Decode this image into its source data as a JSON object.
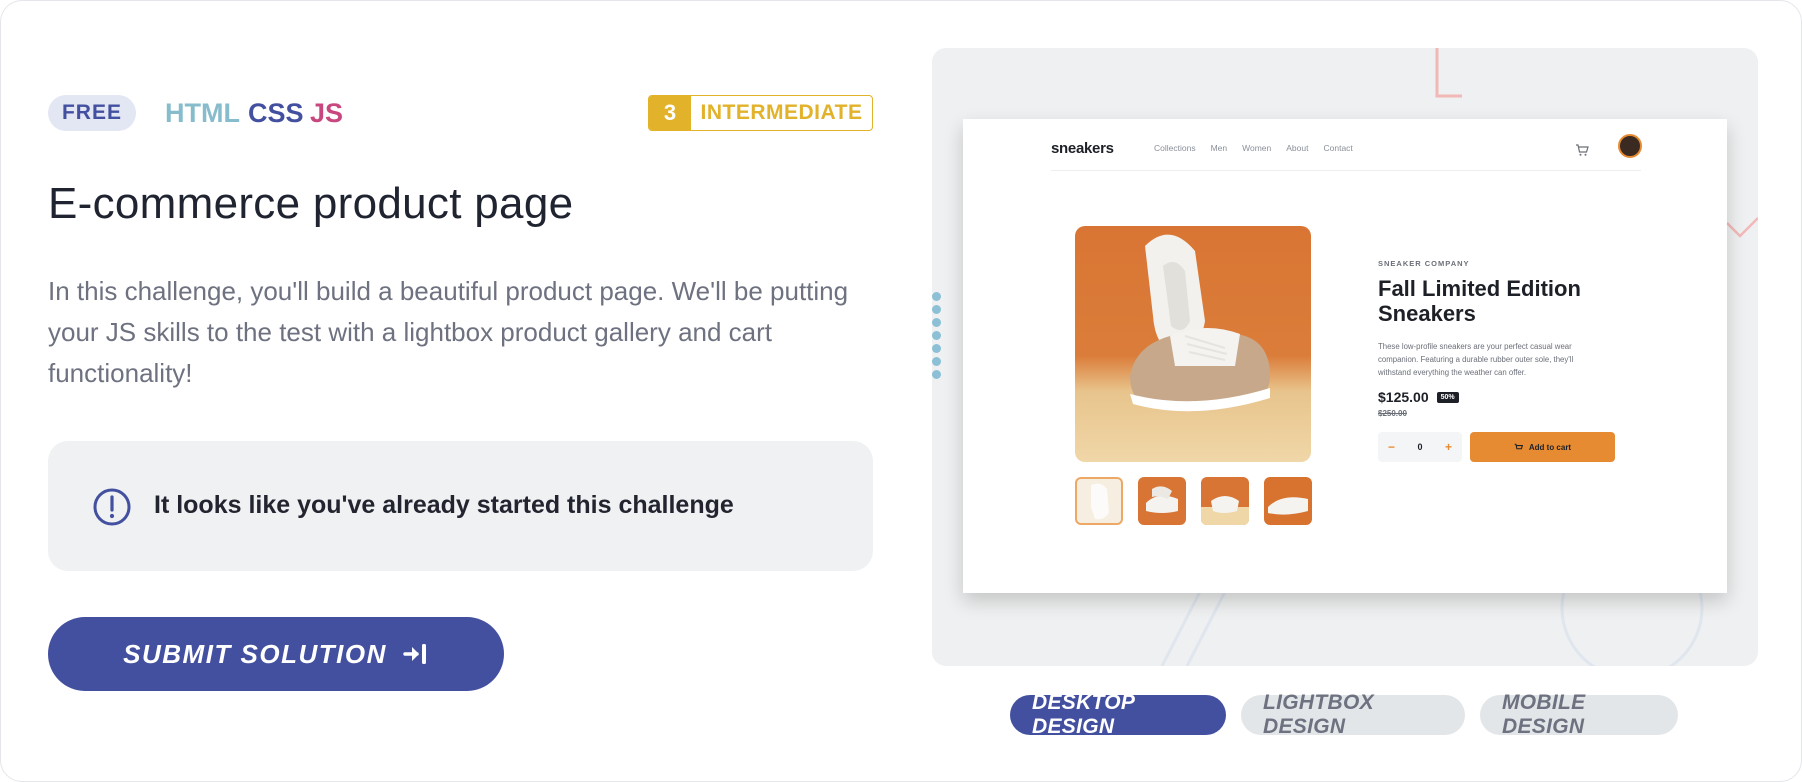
{
  "tags": {
    "free": "FREE",
    "languages": [
      "HTML",
      "CSS",
      "JS"
    ]
  },
  "level": {
    "number": "3",
    "name": "INTERMEDIATE"
  },
  "title": "E-commerce product page",
  "description": "In this challenge, you'll build a beautiful product page. We'll be putting your JS skills to the test with a lightbox product gallery and cart functionality!",
  "notice": {
    "icon": "exclamation-circle-icon",
    "text": "It looks like you've already started this challenge"
  },
  "submit": {
    "label": "SUBMIT SOLUTION",
    "icon": "sign-in-arrow-icon"
  },
  "preview": {
    "logo": "sneakers",
    "nav_links": [
      "Collections",
      "Men",
      "Women",
      "About",
      "Contact"
    ],
    "company": "SNEAKER COMPANY",
    "product_name": "Fall Limited Edition Sneakers",
    "product_desc": "These low-profile sneakers are your perfect casual wear companion. Featuring a durable rubber outer sole, they'll withstand everything the weather can offer.",
    "price": "$125.00",
    "discount": "50%",
    "old_price": "$250.00",
    "qty_minus": "−",
    "qty_value": "0",
    "qty_plus": "+",
    "add_to_cart": "Add to cart"
  },
  "design_tabs": [
    "DESKTOP DESIGN",
    "LIGHTBOX DESIGN",
    "MOBILE DESIGN"
  ],
  "active_tab": "DESKTOP DESIGN",
  "colors": {
    "primary": "#4350a0",
    "html": "#86bccb",
    "js": "#c8477f",
    "intermediate": "#e2b22b",
    "accent_orange": "#e78b32"
  }
}
